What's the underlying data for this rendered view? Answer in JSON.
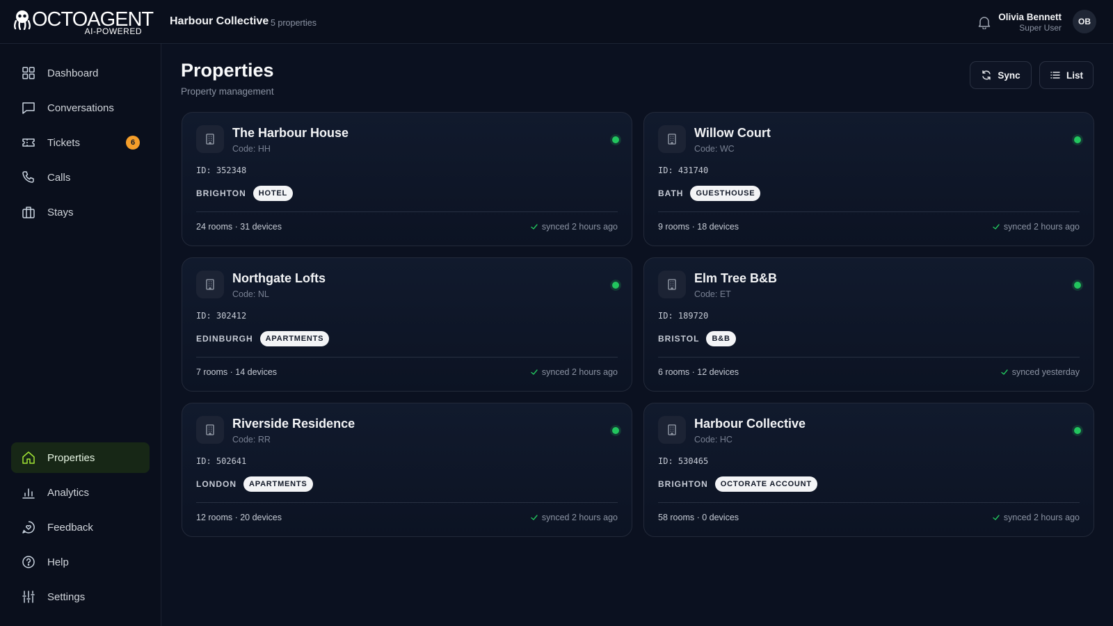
{
  "header": {
    "logo_text": "OCTOAGENT",
    "logo_sub": "AI-POWERED",
    "org_name": "Harbour Collective",
    "org_count": "5 properties",
    "user_name": "Olivia Bennett",
    "user_role": "Super User",
    "avatar_initials": "OB"
  },
  "sidebar": {
    "items": [
      {
        "label": "Dashboard",
        "icon": "grid-icon"
      },
      {
        "label": "Conversations",
        "icon": "chat-icon"
      },
      {
        "label": "Tickets",
        "icon": "ticket-icon",
        "badge": "6"
      },
      {
        "label": "Calls",
        "icon": "phone-icon"
      },
      {
        "label": "Stays",
        "icon": "briefcase-icon"
      },
      {
        "label": "Properties",
        "icon": "home-icon",
        "active": true
      },
      {
        "label": "Analytics",
        "icon": "bar-chart-icon"
      },
      {
        "label": "Feedback",
        "icon": "message-heart-icon"
      },
      {
        "label": "Help",
        "icon": "help-circle-icon"
      },
      {
        "label": "Settings",
        "icon": "sliders-icon"
      }
    ]
  },
  "main": {
    "title": "Properties",
    "subtitle": "Property management",
    "sync_label": "Sync",
    "list_label": "List"
  },
  "properties": [
    {
      "name": "The Harbour House",
      "code": "Code: HH",
      "id": "ID: 352348",
      "city": "BRIGHTON",
      "type": "HOTEL",
      "stats": "24 rooms · 31 devices",
      "synced": "synced 2 hours ago"
    },
    {
      "name": "Willow Court",
      "code": "Code: WC",
      "id": "ID: 431740",
      "city": "BATH",
      "type": "GUESTHOUSE",
      "stats": "9 rooms · 18 devices",
      "synced": "synced 2 hours ago"
    },
    {
      "name": "Northgate Lofts",
      "code": "Code: NL",
      "id": "ID: 302412",
      "city": "EDINBURGH",
      "type": "APARTMENTS",
      "stats": "7 rooms · 14 devices",
      "synced": "synced 2 hours ago"
    },
    {
      "name": "Elm Tree B&B",
      "code": "Code: ET",
      "id": "ID: 189720",
      "city": "BRISTOL",
      "type": "B&B",
      "stats": "6 rooms · 12 devices",
      "synced": "synced yesterday"
    },
    {
      "name": "Riverside Residence",
      "code": "Code: RR",
      "id": "ID: 502641",
      "city": "LONDON",
      "type": "APARTMENTS",
      "stats": "12 rooms · 20 devices",
      "synced": "synced 2 hours ago"
    },
    {
      "name": "Harbour Collective",
      "code": "Code: HC",
      "id": "ID: 530465",
      "city": "BRIGHTON",
      "type": "OCTORATE ACCOUNT",
      "stats": "58 rooms · 0 devices",
      "synced": "synced 2 hours ago"
    }
  ],
  "colors": {
    "background": "#0b1120",
    "active_nav": "#172716",
    "badge": "#f59e2a",
    "status_online": "#22c55e"
  }
}
